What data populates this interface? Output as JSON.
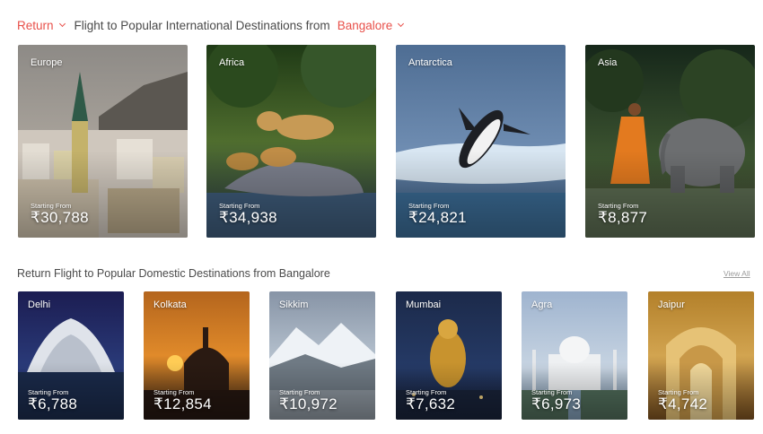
{
  "international": {
    "trip_type": "Return",
    "title": "Flight to Popular International Destinations from",
    "origin": "Bangalore",
    "accent_color": "#e8504a",
    "cards": [
      {
        "name": "Europe",
        "starting_label": "Starting From",
        "price": "₹30,788"
      },
      {
        "name": "Africa",
        "starting_label": "Starting From",
        "price": "₹34,938"
      },
      {
        "name": "Antarctica",
        "starting_label": "Starting From",
        "price": "₹24,821"
      },
      {
        "name": "Asia",
        "starting_label": "Starting From",
        "price": "₹8,877"
      }
    ]
  },
  "domestic": {
    "title": "Return Flight to Popular Domestic Destinations from Bangalore",
    "view_all": "View All",
    "cards": [
      {
        "name": "Delhi",
        "starting_label": "Starting From",
        "price": "₹6,788"
      },
      {
        "name": "Kolkata",
        "starting_label": "Starting From",
        "price": "₹12,854"
      },
      {
        "name": "Sikkim",
        "starting_label": "Starting From",
        "price": "₹10,972"
      },
      {
        "name": "Mumbai",
        "starting_label": "Starting From",
        "price": "₹7,632"
      },
      {
        "name": "Agra",
        "starting_label": "Starting From",
        "price": "₹6,973"
      },
      {
        "name": "Jaipur",
        "starting_label": "Starting From",
        "price": "₹4,742"
      }
    ]
  }
}
